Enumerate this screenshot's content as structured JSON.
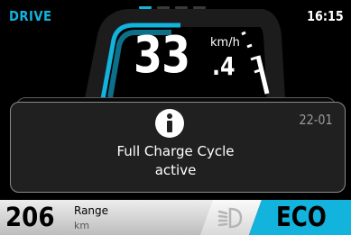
{
  "status_bar": {
    "mode": "DRIVE",
    "clock": "16:15",
    "page_indicator": {
      "count": 4,
      "active_index": 0
    }
  },
  "speedometer": {
    "speed_integer": "33",
    "speed_decimal": ".4",
    "unit": "km/h"
  },
  "notification": {
    "icon": "info-icon",
    "code": "22-01",
    "line1": "Full Charge Cycle",
    "line2": "active"
  },
  "range": {
    "value": "206",
    "label": "Range",
    "unit": "km"
  },
  "lights": {
    "icon": "headlight-icon",
    "state": "off"
  },
  "drive_mode": {
    "label": "ECO"
  },
  "colors": {
    "accent": "#12b3dc",
    "background": "#000000",
    "card": "#202020",
    "range_panel": "#d6d6d6",
    "muted_text": "#9a9a9a"
  }
}
